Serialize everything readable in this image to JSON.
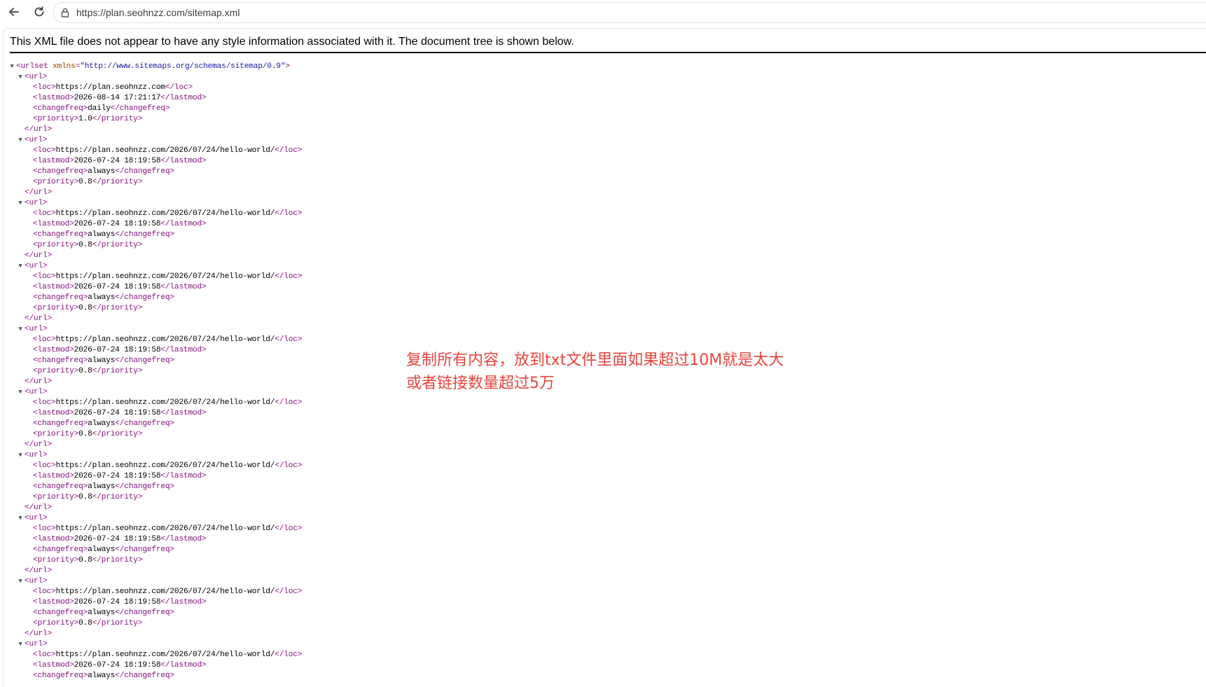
{
  "browser": {
    "url": "https://plan.seohnzz.com/sitemap.xml",
    "icons": {
      "back": "back-arrow-icon",
      "reload": "reload-icon",
      "lock": "lock-icon"
    }
  },
  "page": {
    "info_text": "This XML file does not appear to have any style information associated with it. The document tree is shown below.",
    "root": {
      "open": "<urlset",
      "attr_name": "xmlns",
      "attr_value": "\"http://www.sitemaps.org/schemas/sitemap/0.9\"",
      "close": ">"
    },
    "urls": [
      {
        "loc": "https://plan.seohnzz.com",
        "lastmod": "2026-08-14 17:21:17",
        "changefreq": "daily",
        "priority": "1.0"
      },
      {
        "loc": "https://plan.seohnzz.com/2026/07/24/hello-world/",
        "lastmod": "2026-07-24 18:19:58",
        "changefreq": "always",
        "priority": "0.8"
      },
      {
        "loc": "https://plan.seohnzz.com/2026/07/24/hello-world/",
        "lastmod": "2026-07-24 18:19:58",
        "changefreq": "always",
        "priority": "0.8"
      },
      {
        "loc": "https://plan.seohnzz.com/2026/07/24/hello-world/",
        "lastmod": "2026-07-24 18:19:58",
        "changefreq": "always",
        "priority": "0.8"
      },
      {
        "loc": "https://plan.seohnzz.com/2026/07/24/hello-world/",
        "lastmod": "2026-07-24 18:19:58",
        "changefreq": "always",
        "priority": "0.8"
      },
      {
        "loc": "https://plan.seohnzz.com/2026/07/24/hello-world/",
        "lastmod": "2026-07-24 18:19:58",
        "changefreq": "always",
        "priority": "0.8"
      },
      {
        "loc": "https://plan.seohnzz.com/2026/07/24/hello-world/",
        "lastmod": "2026-07-24 18:19:58",
        "changefreq": "always",
        "priority": "0.8"
      },
      {
        "loc": "https://plan.seohnzz.com/2026/07/24/hello-world/",
        "lastmod": "2026-07-24 18:19:58",
        "changefreq": "always",
        "priority": "0.8"
      },
      {
        "loc": "https://plan.seohnzz.com/2026/07/24/hello-world/",
        "lastmod": "2026-07-24 18:19:58",
        "changefreq": "always",
        "priority": "0.8"
      },
      {
        "loc": "https://plan.seohnzz.com/2026/07/24/hello-world/",
        "lastmod": "2026-07-24 18:19:58",
        "changefreq": "always"
      }
    ]
  },
  "annotation": {
    "line1": "复制所有内容，放到txt文件里面如果超过10M就是太大",
    "line2": "或者链接数量超过5万",
    "color": "#e8453c"
  },
  "colors": {
    "tag": "#881280",
    "attr_name": "#994500",
    "attr_value": "#1a1aa6"
  }
}
